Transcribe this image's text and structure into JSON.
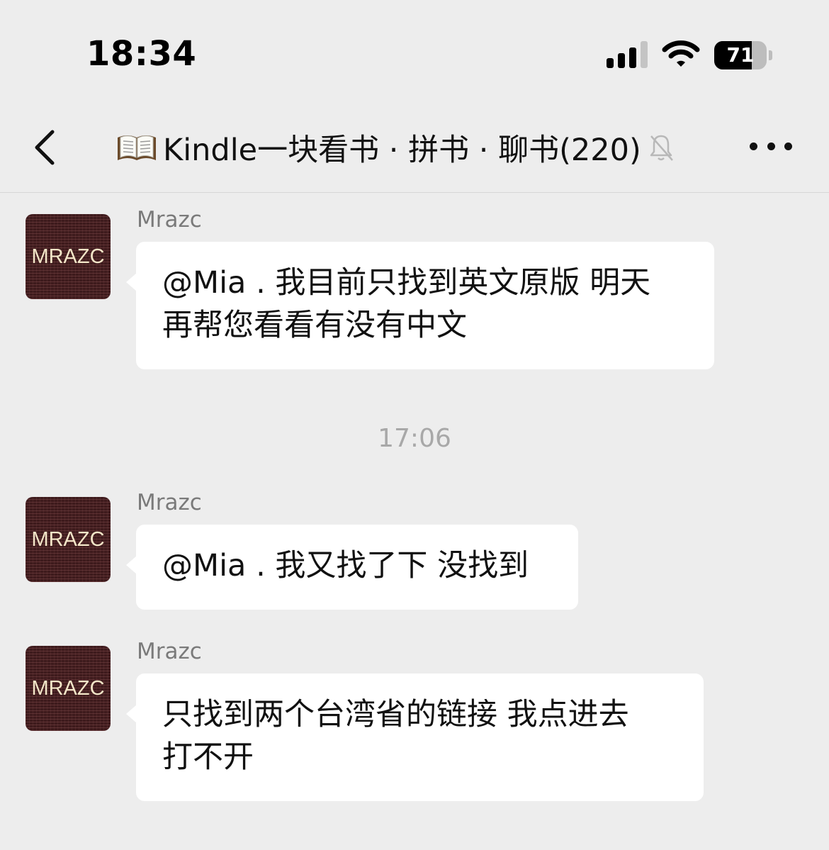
{
  "status_bar": {
    "time": "18:34",
    "battery_percent": "71",
    "battery_level": 0.71,
    "signal_bars": 3,
    "signal_max": 4
  },
  "nav": {
    "title": "Kindle一块看书 · 拼书 · 聊书(220)",
    "title_icon": "open-book-icon",
    "muted_icon": "bell-slash-icon",
    "back_icon": "chevron-left-icon",
    "more_icon": "ellipsis-icon"
  },
  "timestamp": "17:06",
  "avatar_label": "MRAZC",
  "messages": [
    {
      "sender": "Mrazc",
      "lines": [
        "@Mia . 我目前只找到英文原版 明天",
        "再帮您看看有没有中文"
      ]
    },
    {
      "sender": "Mrazc",
      "lines": [
        "@Mia . 我又找了下 没找到"
      ]
    },
    {
      "sender": "Mrazc",
      "lines": [
        "只找到两个台湾省的链接 我点进去",
        "打不开"
      ]
    }
  ]
}
